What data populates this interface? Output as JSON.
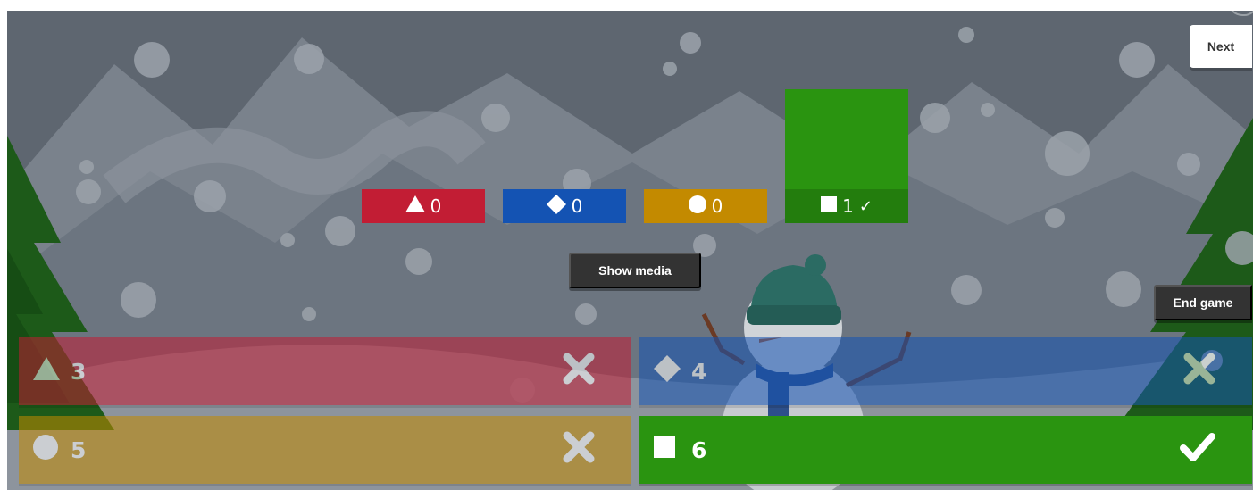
{
  "header": {
    "next_label": "Next"
  },
  "controls": {
    "show_media_label": "Show media",
    "end_game_label": "End game"
  },
  "results": {
    "bars": [
      {
        "shape": "triangle",
        "count": "0",
        "color": "#c21d34",
        "correct": false
      },
      {
        "shape": "diamond",
        "count": "0",
        "color": "#1453b3",
        "correct": false
      },
      {
        "shape": "circle",
        "count": "0",
        "color": "#c38a00",
        "correct": false
      },
      {
        "shape": "square",
        "count": "1",
        "color": "#268e0f",
        "correct": true,
        "check": "✓"
      }
    ]
  },
  "answers": [
    {
      "shape": "triangle",
      "text": "3",
      "color": "#c21d34",
      "correct": false,
      "mark_icon": "cross-icon"
    },
    {
      "shape": "diamond",
      "text": "4",
      "color": "#1453b3",
      "correct": false,
      "mark_icon": "cross-icon"
    },
    {
      "shape": "circle",
      "text": "5",
      "color": "#c38a00",
      "correct": false,
      "mark_icon": "cross-icon"
    },
    {
      "shape": "square",
      "text": "6",
      "color": "#268e0f",
      "correct": true,
      "mark_icon": "check-icon"
    }
  ],
  "background": {
    "scene": "winter-mountains-snowman",
    "colors": {
      "sky": "#5e6670",
      "mountain": "#7d8590",
      "tree": "#1f5e1a",
      "snow": "#aeb3b9"
    }
  }
}
